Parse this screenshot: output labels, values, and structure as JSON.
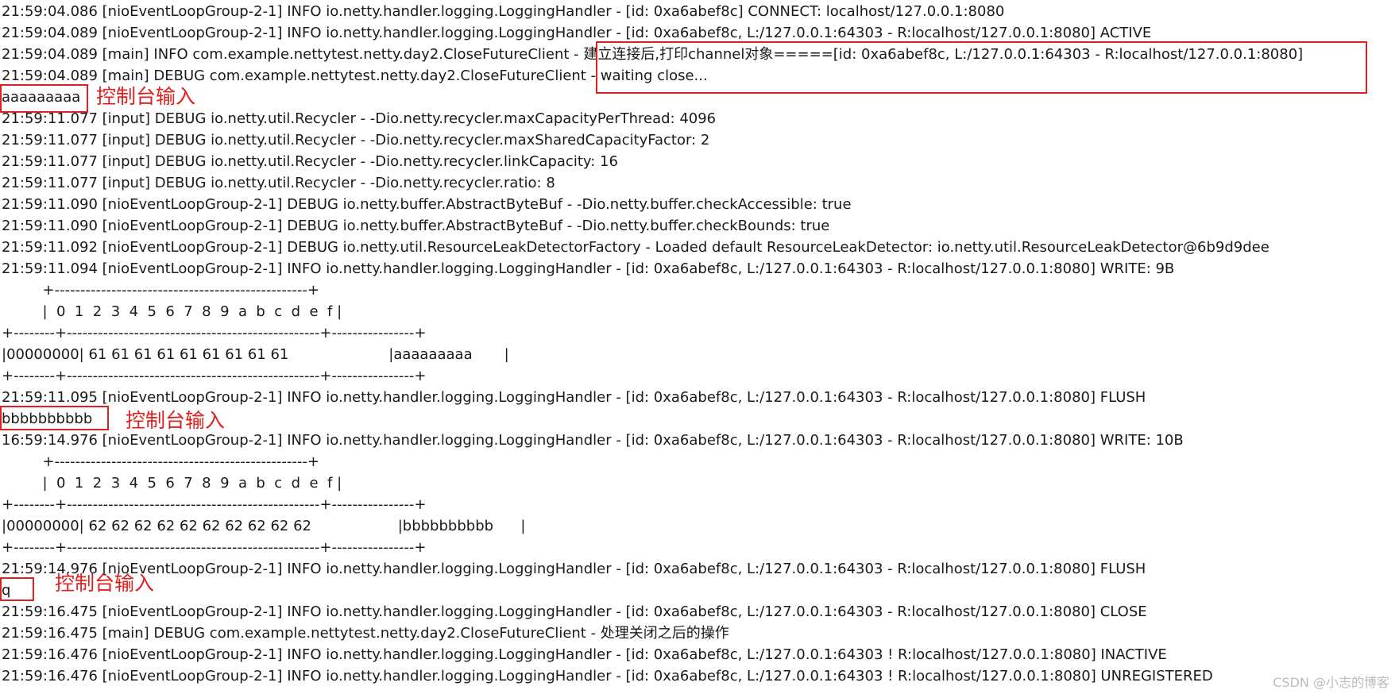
{
  "console": {
    "lines": [
      "21:59:04.086 [nioEventLoopGroup-2-1] INFO io.netty.handler.logging.LoggingHandler - [id: 0xa6abef8c] CONNECT: localhost/127.0.0.1:8080",
      "21:59:04.089 [nioEventLoopGroup-2-1] INFO io.netty.handler.logging.LoggingHandler - [id: 0xa6abef8c, L:/127.0.0.1:64303 - R:localhost/127.0.0.1:8080] ACTIVE",
      "21:59:04.089 [main] INFO com.example.nettytest.netty.day2.CloseFutureClient - 建立连接后,打印channel对象=====[id: 0xa6abef8c, L:/127.0.0.1:64303 - R:localhost/127.0.0.1:8080]",
      "21:59:04.089 [main] DEBUG com.example.nettytest.netty.day2.CloseFutureClient - waiting close...",
      "aaaaaaaaa",
      "21:59:11.077 [input] DEBUG io.netty.util.Recycler - -Dio.netty.recycler.maxCapacityPerThread: 4096",
      "21:59:11.077 [input] DEBUG io.netty.util.Recycler - -Dio.netty.recycler.maxSharedCapacityFactor: 2",
      "21:59:11.077 [input] DEBUG io.netty.util.Recycler - -Dio.netty.recycler.linkCapacity: 16",
      "21:59:11.077 [input] DEBUG io.netty.util.Recycler - -Dio.netty.recycler.ratio: 8",
      "21:59:11.090 [nioEventLoopGroup-2-1] DEBUG io.netty.buffer.AbstractByteBuf - -Dio.netty.buffer.checkAccessible: true",
      "21:59:11.090 [nioEventLoopGroup-2-1] DEBUG io.netty.buffer.AbstractByteBuf - -Dio.netty.buffer.checkBounds: true",
      "21:59:11.092 [nioEventLoopGroup-2-1] DEBUG io.netty.util.ResourceLeakDetectorFactory - Loaded default ResourceLeakDetector: io.netty.util.ResourceLeakDetector@6b9d9dee",
      "21:59:11.094 [nioEventLoopGroup-2-1] INFO io.netty.handler.logging.LoggingHandler - [id: 0xa6abef8c, L:/127.0.0.1:64303 - R:localhost/127.0.0.1:8080] WRITE: 9B",
      "         +-------------------------------------------------+",
      "         |  0  1  2  3  4  5  6  7  8  9  a  b  c  d  e  f |",
      "+--------+-------------------------------------------------+----------------+",
      "|00000000| 61 61 61 61 61 61 61 61 61                      |aaaaaaaaa       |",
      "+--------+-------------------------------------------------+----------------+",
      "21:59:11.095 [nioEventLoopGroup-2-1] INFO io.netty.handler.logging.LoggingHandler - [id: 0xa6abef8c, L:/127.0.0.1:64303 - R:localhost/127.0.0.1:8080] FLUSH",
      "bbbbbbbbbb",
      "16:59:14.976 [nioEventLoopGroup-2-1] INFO io.netty.handler.logging.LoggingHandler - [id: 0xa6abef8c, L:/127.0.0.1:64303 - R:localhost/127.0.0.1:8080] WRITE: 10B",
      "         +-------------------------------------------------+",
      "         |  0  1  2  3  4  5  6  7  8  9  a  b  c  d  e  f |",
      "+--------+-------------------------------------------------+----------------+",
      "|00000000| 62 62 62 62 62 62 62 62 62 62                   |bbbbbbbbbb      |",
      "+--------+-------------------------------------------------+----------------+",
      "21:59:14.976 [nioEventLoopGroup-2-1] INFO io.netty.handler.logging.LoggingHandler - [id: 0xa6abef8c, L:/127.0.0.1:64303 - R:localhost/127.0.0.1:8080] FLUSH",
      "q",
      "21:59:16.475 [nioEventLoopGroup-2-1] INFO io.netty.handler.logging.LoggingHandler - [id: 0xa6abef8c, L:/127.0.0.1:64303 - R:localhost/127.0.0.1:8080] CLOSE",
      "21:59:16.475 [main] DEBUG com.example.nettytest.netty.day2.CloseFutureClient - 处理关闭之后的操作",
      "21:59:16.476 [nioEventLoopGroup-2-1] INFO io.netty.handler.logging.LoggingHandler - [id: 0xa6abef8c, L:/127.0.0.1:64303 ! R:localhost/127.0.0.1:8080] INACTIVE",
      "21:59:16.476 [nioEventLoopGroup-2-1] INFO io.netty.handler.logging.LoggingHandler - [id: 0xa6abef8c, L:/127.0.0.1:64303 ! R:localhost/127.0.0.1:8080] UNREGISTERED"
    ]
  },
  "annotations": {
    "console_input_label": "控制台输入"
  },
  "watermark": "CSDN @小志的博客",
  "colors": {
    "background": "#ffffff",
    "text": "#1a1a1a",
    "highlight": "#e02020",
    "watermark": "#bbbbbb"
  }
}
